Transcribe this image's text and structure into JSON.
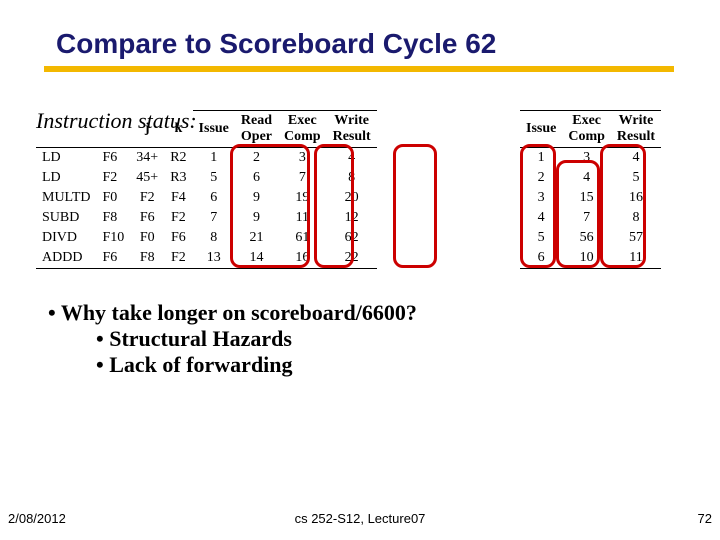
{
  "title": "Compare to Scoreboard Cycle 62",
  "section_label": "Instruction status:",
  "headers_left": {
    "instr": "Instruction",
    "j": "j",
    "k": "k",
    "issue": "Issue",
    "read": "Read Oper",
    "exec": "Exec Comp",
    "write": "Write Result"
  },
  "headers_right": {
    "issue": "Issue",
    "exec": "Exec Comp",
    "write": "Write Result"
  },
  "rows": [
    {
      "op": "LD",
      "fi": "F6",
      "j": "34+",
      "k": "R2",
      "issue": 1,
      "read": 2,
      "exec": 3,
      "write": 4
    },
    {
      "op": "LD",
      "fi": "F2",
      "j": "45+",
      "k": "R3",
      "issue": 5,
      "read": 6,
      "exec": 7,
      "write": 8
    },
    {
      "op": "MULTD",
      "fi": "F0",
      "j": "F2",
      "k": "F4",
      "issue": 6,
      "read": 9,
      "exec": 19,
      "write": 20
    },
    {
      "op": "SUBD",
      "fi": "F8",
      "j": "F6",
      "k": "F2",
      "issue": 7,
      "read": 9,
      "exec": 11,
      "write": 12
    },
    {
      "op": "DIVD",
      "fi": "F10",
      "j": "F0",
      "k": "F6",
      "issue": 8,
      "read": 21,
      "exec": 61,
      "write": 62
    },
    {
      "op": "ADDD",
      "fi": "F6",
      "j": "F8",
      "k": "F2",
      "issue": 13,
      "read": 14,
      "exec": 16,
      "write": 22
    }
  ],
  "rows_right": [
    {
      "issue": 1,
      "exec": 3,
      "write": 4
    },
    {
      "issue": 2,
      "exec": 4,
      "write": 5
    },
    {
      "issue": 3,
      "exec": 15,
      "write": 16
    },
    {
      "issue": 4,
      "exec": 7,
      "write": 8
    },
    {
      "issue": 5,
      "exec": 56,
      "write": 57
    },
    {
      "issue": 6,
      "exec": 10,
      "write": 11
    }
  ],
  "bullets": {
    "q": "Why take longer on scoreboard/6600?",
    "a1": "Structural Hazards",
    "a2": "Lack of forwarding"
  },
  "footer": {
    "date": "2/08/2012",
    "center": "cs 252-S12, Lecture07",
    "page": "72"
  }
}
